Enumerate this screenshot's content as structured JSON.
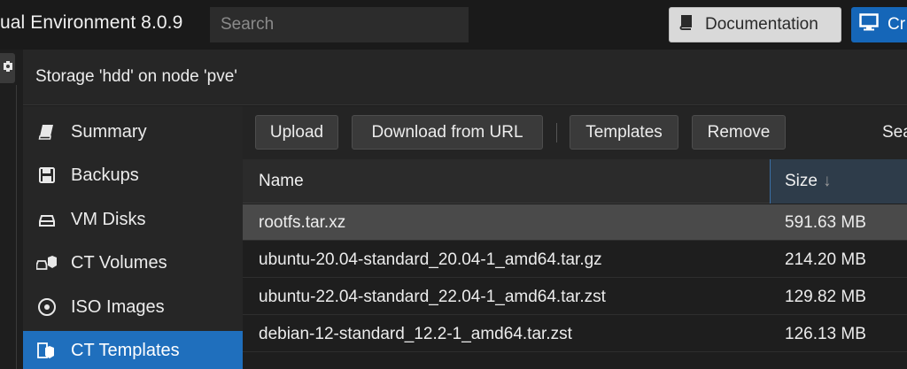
{
  "header": {
    "title": "ual Environment 8.0.9",
    "search_placeholder": "Search",
    "documentation_label": "Documentation",
    "create_label": "Cr"
  },
  "panel": {
    "title": "Storage 'hdd' on node 'pve'"
  },
  "nav": {
    "items": [
      {
        "label": "Summary",
        "icon": "book-icon",
        "active": false
      },
      {
        "label": "Backups",
        "icon": "floppy-icon",
        "active": false
      },
      {
        "label": "VM Disks",
        "icon": "hdd-icon",
        "active": false
      },
      {
        "label": "CT Volumes",
        "icon": "ct-volume-icon",
        "active": false
      },
      {
        "label": "ISO Images",
        "icon": "disc-icon",
        "active": false
      },
      {
        "label": "CT Templates",
        "icon": "ct-template-icon",
        "active": true
      }
    ]
  },
  "toolbar": {
    "upload_label": "Upload",
    "download_label": "Download from URL",
    "templates_label": "Templates",
    "remove_label": "Remove",
    "search_label": "Sea"
  },
  "grid": {
    "columns": {
      "name": "Name",
      "size": "Size"
    },
    "sort_indicator": "↓",
    "rows": [
      {
        "name": "rootfs.tar.xz",
        "size": "591.63 MB",
        "selected": true
      },
      {
        "name": "ubuntu-20.04-standard_20.04-1_amd64.tar.gz",
        "size": "214.20 MB",
        "selected": false
      },
      {
        "name": "ubuntu-22.04-standard_22.04-1_amd64.tar.zst",
        "size": "129.82 MB",
        "selected": false
      },
      {
        "name": "debian-12-standard_12.2-1_amd64.tar.zst",
        "size": "126.13 MB",
        "selected": false
      }
    ]
  },
  "colors": {
    "accent": "#1f6fbd",
    "create_button": "#1566b8",
    "selected_row": "#4a4a4a"
  }
}
